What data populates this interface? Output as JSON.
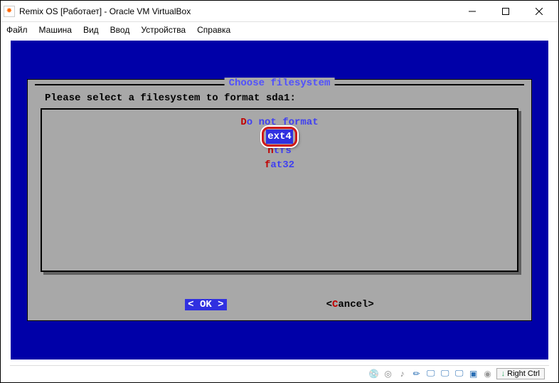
{
  "window": {
    "title": "Remix OS [Работает] - Oracle VM VirtualBox"
  },
  "menu": {
    "file": "Файл",
    "machine": "Машина",
    "view": "Вид",
    "input": "Ввод",
    "devices": "Устройства",
    "help": "Справка"
  },
  "dialog": {
    "title": "Choose filesystem",
    "prompt": "Please select a filesystem to format sda1:",
    "options": [
      {
        "hot": "D",
        "rest": "o not format"
      },
      {
        "hot": "e",
        "rest": "xt4",
        "selected": true
      },
      {
        "hot": "n",
        "rest": "tfs"
      },
      {
        "hot": "f",
        "rest": "at32"
      }
    ],
    "ok_open": "<  ",
    "ok_hot": "O",
    "ok_rest": "K  >",
    "cancel_open": "<",
    "cancel_hot": "C",
    "cancel_rest": "ancel>"
  },
  "status": {
    "hostkey": "Right Ctrl"
  },
  "icons": {
    "hdd": "💿",
    "cd": "◎",
    "audio": "♪",
    "usb": "✏",
    "net": "🖵",
    "shared": "🖵",
    "display": "🖵",
    "chip": "▣",
    "rec": "◉",
    "arrow": "↓"
  }
}
